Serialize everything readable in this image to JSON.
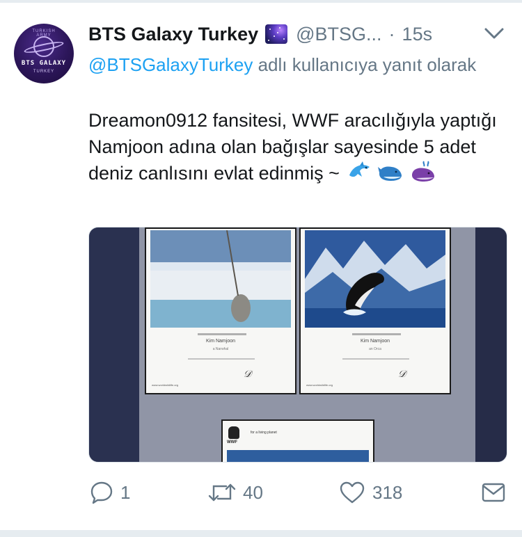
{
  "tweet": {
    "display_name": "BTS Galaxy Turkey",
    "handle": "@BTSG...",
    "separator": "·",
    "time": "15s",
    "reply_mention": "@BTSGalaxyTurkey",
    "reply_suffix": " adlı kullanıcıya yanıt olarak",
    "text": "Dreamon0912 fansitesi, WWF aracılığıyla yaptığı Namjoon adına olan bağışlar sayesinde 5 adet deniz canlısını evlat edinmiş ~",
    "emojis": [
      "dolphin",
      "whale",
      "spouting-whale"
    ]
  },
  "avatar": {
    "line1": "BTS GALAXY",
    "line2": "TURKEY",
    "arc_text": "TURKISH ARMY"
  },
  "media": {
    "certificate_left": {
      "on_behalf": "On behalf of",
      "name": "Kim Namjoon",
      "animal": "a Narwhal",
      "site": "www.worldwildlife.org"
    },
    "certificate_right": {
      "on_behalf": "On behalf of",
      "name": "Kim Namjoon",
      "animal": "an Orca",
      "site": "www.worldwildlife.org"
    },
    "certificate_bottom": {
      "org": "WWF",
      "line": "for a living planet"
    }
  },
  "actions": {
    "reply_count": "1",
    "retweet_count": "40",
    "like_count": "318"
  },
  "colors": {
    "link": "#1da1f2",
    "secondary": "#657786",
    "text": "#14171a"
  }
}
